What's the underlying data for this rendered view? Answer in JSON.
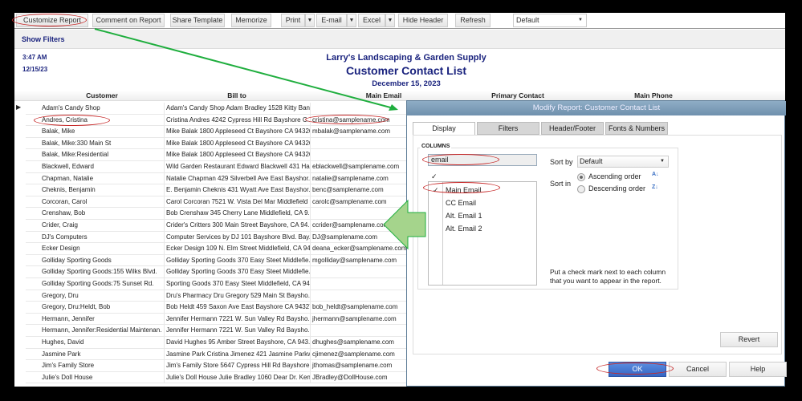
{
  "toolbar": {
    "customize": "Customize Report",
    "comment": "Comment on Report",
    "share": "Share Template",
    "memorize": "Memorize",
    "print": "Print",
    "email": "E-mail",
    "excel": "Excel",
    "hide_header": "Hide Header",
    "refresh": "Refresh",
    "dropdown_arrow": "▼",
    "view_select": "Default"
  },
  "filters": {
    "show_filters": "Show Filters"
  },
  "report": {
    "time": "3:47 AM",
    "date": "12/15/23",
    "company": "Larry's Landscaping & Garden Supply",
    "title": "Customer Contact List",
    "as_of": "December 15, 2023",
    "columns": [
      "Customer",
      "Bill to",
      "Main Email",
      "Primary Contact",
      "Main Phone"
    ],
    "rows": [
      [
        "Adam's Candy Shop",
        "Adam's Candy Shop Adam Bradley 1528 Kitty Ban...",
        ""
      ],
      [
        "Andres, Cristina",
        "Cristina Andres 4242 Cypress Hill Rd Bayshore C...",
        "cristina@samplename.com"
      ],
      [
        "Balak, Mike",
        "Mike Balak 1800 Appleseed Ct Bayshore CA 94326",
        "mbalak@samplename.com"
      ],
      [
        "Balak, Mike:330 Main St",
        "Mike Balak 1800 Appleseed Ct Bayshore CA 94326",
        ""
      ],
      [
        "Balak, Mike:Residential",
        "Mike Balak 1800 Appleseed Ct Bayshore CA 94326",
        ""
      ],
      [
        "Blackwell, Edward",
        "Wild Garden Restaurant Edward Blackwell 431 Ha...",
        "eblackwell@samplename.com"
      ],
      [
        "Chapman, Natalie",
        "Natalie Chapman 429 Silverbell Ave East Bayshor...",
        "natalie@samplename.com"
      ],
      [
        "Cheknis, Benjamin",
        "E. Benjamin Cheknis 431 Wyatt Ave East Bayshor...",
        "benc@samplename.com"
      ],
      [
        "Corcoran, Carol",
        "Carol Corcoran 7521 W. Vista Del Mar Middlefield ...",
        "carolc@samplename.com"
      ],
      [
        "Crenshaw, Bob",
        "Bob Crenshaw 345 Cherry Lane Middlefield, CA 9...",
        ""
      ],
      [
        "Crider, Craig",
        "Crider's Critters 300 Main Street Bayshore, CA 94...",
        "ccrider@samplename.com"
      ],
      [
        "DJ's Computers",
        "Computer Services by DJ 101 Bayshore Blvd. Bay...",
        "DJ@samplename.com"
      ],
      [
        "Ecker Design",
        "Ecker Design 109 N. Elm Street Middlefield, CA 94...",
        "deana_ecker@samplename.com"
      ],
      [
        "Golliday Sporting Goods",
        "Golliday Sporting Goods 370 Easy Steet Middlefie...",
        "mgolliday@samplename.com"
      ],
      [
        "Golliday Sporting Goods:155 Wilks Blvd.",
        "Golliday Sporting Goods 370 Easy Steet Middlefie...",
        ""
      ],
      [
        "Golliday Sporting Goods:75 Sunset Rd.",
        "Sporting Goods 370 Easy Steet Middlefield, CA 94...",
        ""
      ],
      [
        "Gregory, Dru",
        "Dru's Pharmacy Dru Gregory 529 Main St Baysho...",
        ""
      ],
      [
        "Gregory, Dru:Heldt, Bob",
        "Bob Heldt 459 Saxon Ave East Bayshore CA 94327",
        "bob_heldt@samplename.com"
      ],
      [
        "Hermann, Jennifer",
        "Jennifer Hermann 7221 W. Sun Valley Rd Baysho...",
        "jhermann@samplename.com"
      ],
      [
        "Hermann, Jennifer:Residential Maintenan...",
        "Jennifer Hermann 7221 W. Sun Valley Rd Baysho...",
        ""
      ],
      [
        "Hughes, David",
        "David Hughes 95 Amber Street Bayshore, CA 943...",
        "dhughes@samplename.com"
      ],
      [
        "Jasmine Park",
        "Jasmine Park Cristina Jimenez 421 Jasmine Parkw...",
        "cjimenez@samplename.com"
      ],
      [
        "Jim's Family Store",
        "Jim's Family Store 5647 Cypress Hill Rd Bayshore...",
        "jthomas@samplename.com"
      ],
      [
        "Julie's Doll House",
        "Julie's Doll House Julie Bradley 1060 Dear Dr. Ken...",
        "JBradley@DollHouse.com"
      ]
    ]
  },
  "dialog": {
    "title": "Modify Report: Customer Contact List",
    "tabs": [
      "Display",
      "Filters",
      "Header/Footer",
      "Fonts & Numbers"
    ],
    "columns_label": "COLUMNS",
    "search_value": "email",
    "check_header": "✓",
    "column_items": [
      {
        "label": "Main Email",
        "checked": true
      },
      {
        "label": "CC Email",
        "checked": false
      },
      {
        "label": "Alt. Email 1",
        "checked": false
      },
      {
        "label": "Alt. Email 2",
        "checked": false
      }
    ],
    "check_mark": "✓",
    "sort_by_label": "Sort by",
    "sort_by_value": "Default",
    "sort_in_label": "Sort in",
    "ascending": "Ascending order",
    "descending": "Descending order",
    "sort_selected": "ascending",
    "help_text_1": "Put a check mark next to each column",
    "help_text_2": "that you want to appear in the report.",
    "revert": "Revert",
    "ok": "OK",
    "cancel": "Cancel",
    "help": "Help"
  },
  "colors": {
    "title_bar": "#7d9bb5",
    "ok": "#3d6fcc",
    "annotation_red": "#c62828",
    "annotation_green": "#1fae3e",
    "report_blue": "#1a237e"
  }
}
